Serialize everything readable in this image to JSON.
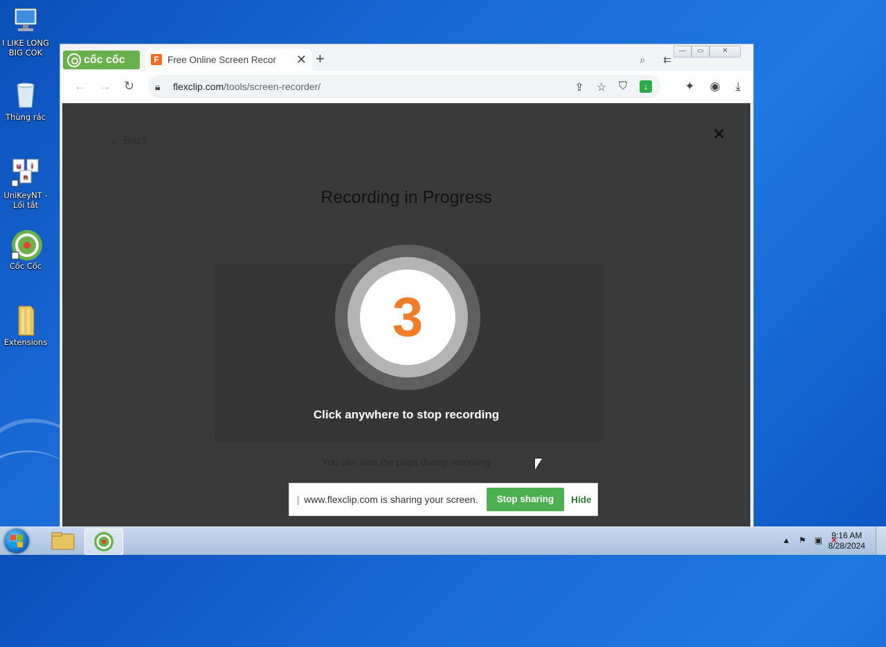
{
  "desktop": {
    "icons": [
      {
        "label": "I LIKE LONG BIG COK"
      },
      {
        "label": "Thùng rác"
      },
      {
        "label": "UniKeyNT - Lối tắt"
      },
      {
        "label": "Cốc Cốc"
      },
      {
        "label": "Extensions"
      }
    ]
  },
  "browser": {
    "brand_label": "cốc cốc",
    "tab": {
      "title": "Free Online Screen Recor",
      "favicon": "F"
    },
    "address": {
      "host": "flexclip.com",
      "path": "/tools/screen-recorder/"
    }
  },
  "page": {
    "back_label": "← Back",
    "title": "Recording in Progress",
    "countdown": "3",
    "stop_hint": "Click anywhere to stop recording",
    "hide_hint": "You can hide the page during recording",
    "colors": {
      "countdown": "#f07d2a",
      "overlay": "#3a3a3a"
    }
  },
  "sharebar": {
    "message": "www.flexclip.com is sharing your screen.",
    "stop_label": "Stop sharing",
    "hide_label": "Hide",
    "colors": {
      "stop": "#4caf50"
    }
  },
  "taskbar": {
    "time": "9:16 AM",
    "date": "8/28/2024"
  }
}
